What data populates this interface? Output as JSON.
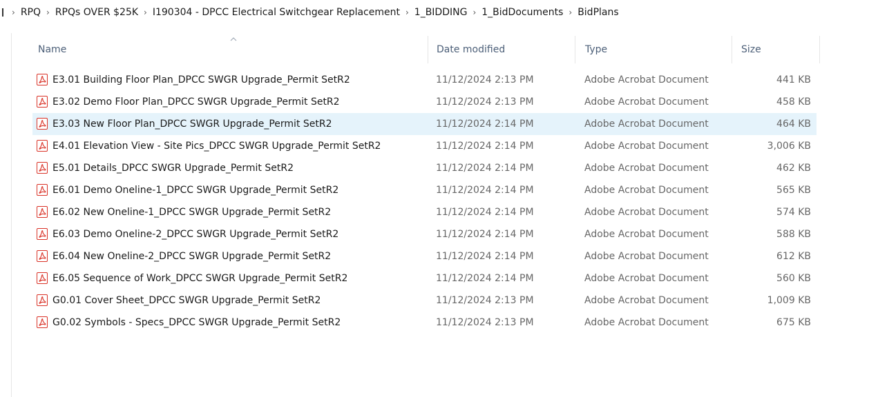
{
  "breadcrumb": {
    "items": [
      "RPQ",
      "RPQs OVER $25K",
      "I190304 - DPCC Electrical Switchgear Replacement",
      "1_BIDDING",
      "1_BidDocuments",
      "BidPlans"
    ]
  },
  "columns": {
    "name": "Name",
    "date_modified": "Date modified",
    "type": "Type",
    "size": "Size"
  },
  "sort": {
    "column": "name",
    "direction": "ascending"
  },
  "colors": {
    "selected_row": "#e5f3fb",
    "pdf_icon": "#d93025",
    "header_text": "#4c5f78",
    "secondary_text": "#666666"
  },
  "files": [
    {
      "icon": "pdf-icon",
      "name": "E3.01 Building Floor Plan_DPCC SWGR Upgrade_Permit SetR2",
      "date": "11/12/2024 2:13 PM",
      "type": "Adobe Acrobat Document",
      "size": "441 KB",
      "selected": false
    },
    {
      "icon": "pdf-icon",
      "name": "E3.02 Demo Floor Plan_DPCC SWGR Upgrade_Permit SetR2",
      "date": "11/12/2024 2:13 PM",
      "type": "Adobe Acrobat Document",
      "size": "458 KB",
      "selected": false
    },
    {
      "icon": "pdf-icon",
      "name": "E3.03 New Floor Plan_DPCC SWGR Upgrade_Permit SetR2",
      "date": "11/12/2024 2:14 PM",
      "type": "Adobe Acrobat Document",
      "size": "464 KB",
      "selected": true
    },
    {
      "icon": "pdf-icon",
      "name": "E4.01 Elevation View - Site Pics_DPCC SWGR Upgrade_Permit SetR2",
      "date": "11/12/2024 2:14 PM",
      "type": "Adobe Acrobat Document",
      "size": "3,006 KB",
      "selected": false
    },
    {
      "icon": "pdf-icon",
      "name": "E5.01 Details_DPCC SWGR Upgrade_Permit SetR2",
      "date": "11/12/2024 2:14 PM",
      "type": "Adobe Acrobat Document",
      "size": "462 KB",
      "selected": false
    },
    {
      "icon": "pdf-icon",
      "name": "E6.01 Demo Oneline-1_DPCC SWGR Upgrade_Permit SetR2",
      "date": "11/12/2024 2:14 PM",
      "type": "Adobe Acrobat Document",
      "size": "565 KB",
      "selected": false
    },
    {
      "icon": "pdf-icon",
      "name": "E6.02 New Oneline-1_DPCC SWGR Upgrade_Permit SetR2",
      "date": "11/12/2024 2:14 PM",
      "type": "Adobe Acrobat Document",
      "size": "574 KB",
      "selected": false
    },
    {
      "icon": "pdf-icon",
      "name": "E6.03 Demo Oneline-2_DPCC SWGR Upgrade_Permit SetR2",
      "date": "11/12/2024 2:14 PM",
      "type": "Adobe Acrobat Document",
      "size": "588 KB",
      "selected": false
    },
    {
      "icon": "pdf-icon",
      "name": "E6.04 New Oneline-2_DPCC SWGR Upgrade_Permit SetR2",
      "date": "11/12/2024 2:14 PM",
      "type": "Adobe Acrobat Document",
      "size": "612 KB",
      "selected": false
    },
    {
      "icon": "pdf-icon",
      "name": "E6.05 Sequence of Work_DPCC SWGR Upgrade_Permit SetR2",
      "date": "11/12/2024 2:14 PM",
      "type": "Adobe Acrobat Document",
      "size": "560 KB",
      "selected": false
    },
    {
      "icon": "pdf-icon",
      "name": "G0.01 Cover Sheet_DPCC SWGR Upgrade_Permit SetR2",
      "date": "11/12/2024 2:13 PM",
      "type": "Adobe Acrobat Document",
      "size": "1,009 KB",
      "selected": false
    },
    {
      "icon": "pdf-icon",
      "name": "G0.02 Symbols - Specs_DPCC SWGR Upgrade_Permit SetR2",
      "date": "11/12/2024 2:13 PM",
      "type": "Adobe Acrobat Document",
      "size": "675 KB",
      "selected": false
    }
  ]
}
